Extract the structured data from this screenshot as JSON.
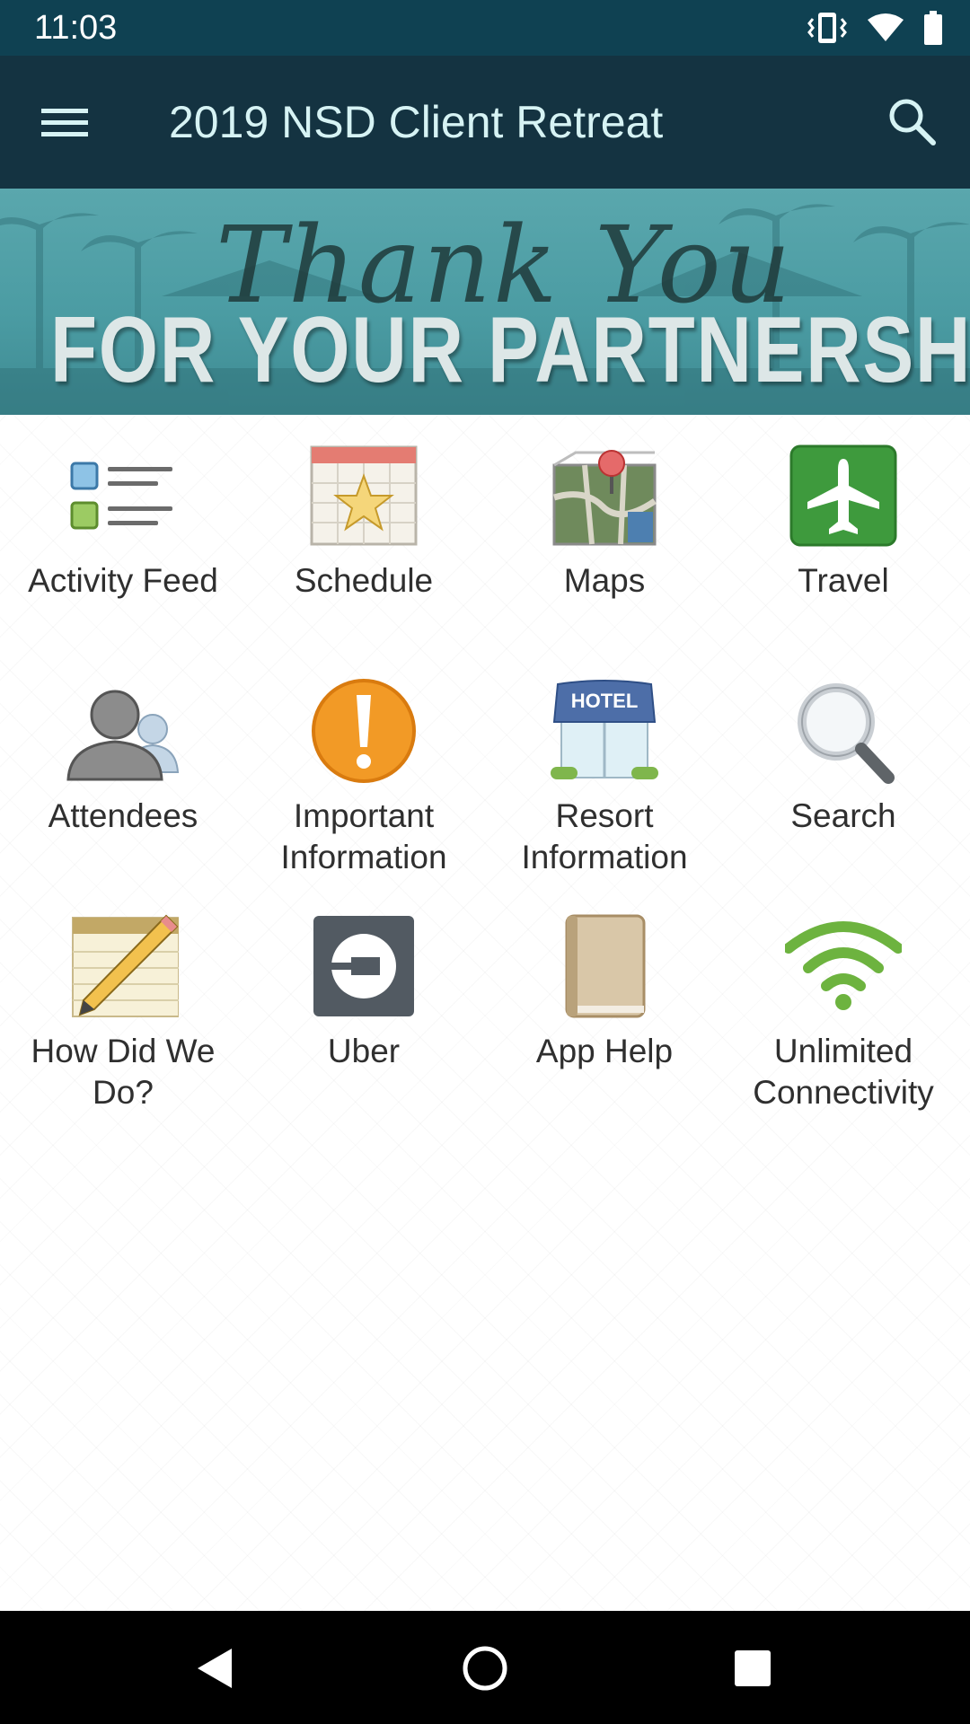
{
  "status_bar": {
    "time": "11:03"
  },
  "app_bar": {
    "title": "2019 NSD Client Retreat",
    "menu_icon": "hamburger-menu-icon",
    "search_icon": "search-icon"
  },
  "banner": {
    "script_text": "Thank You",
    "main_text": "FOR YOUR PARTNERSHIP!"
  },
  "tiles": [
    {
      "label": "Activity Feed",
      "icon": "activity-feed-icon"
    },
    {
      "label": "Schedule",
      "icon": "calendar-star-icon"
    },
    {
      "label": "Maps",
      "icon": "map-pin-icon"
    },
    {
      "label": "Travel",
      "icon": "airplane-icon"
    },
    {
      "label": "Attendees",
      "icon": "people-icon"
    },
    {
      "label": "Important Information",
      "icon": "exclamation-icon"
    },
    {
      "label": "Resort Information",
      "icon": "hotel-icon"
    },
    {
      "label": "Search",
      "icon": "magnifier-icon"
    },
    {
      "label": "How Did We Do?",
      "icon": "notepad-pencil-icon"
    },
    {
      "label": "Uber",
      "icon": "uber-icon"
    },
    {
      "label": "App Help",
      "icon": "book-icon"
    },
    {
      "label": "Unlimited Connectivity",
      "icon": "wifi-icon"
    }
  ],
  "colors": {
    "status_bar": "#0f4152",
    "app_bar": "#143341",
    "title": "#d6f3f4",
    "banner": "#4b9ca3"
  }
}
